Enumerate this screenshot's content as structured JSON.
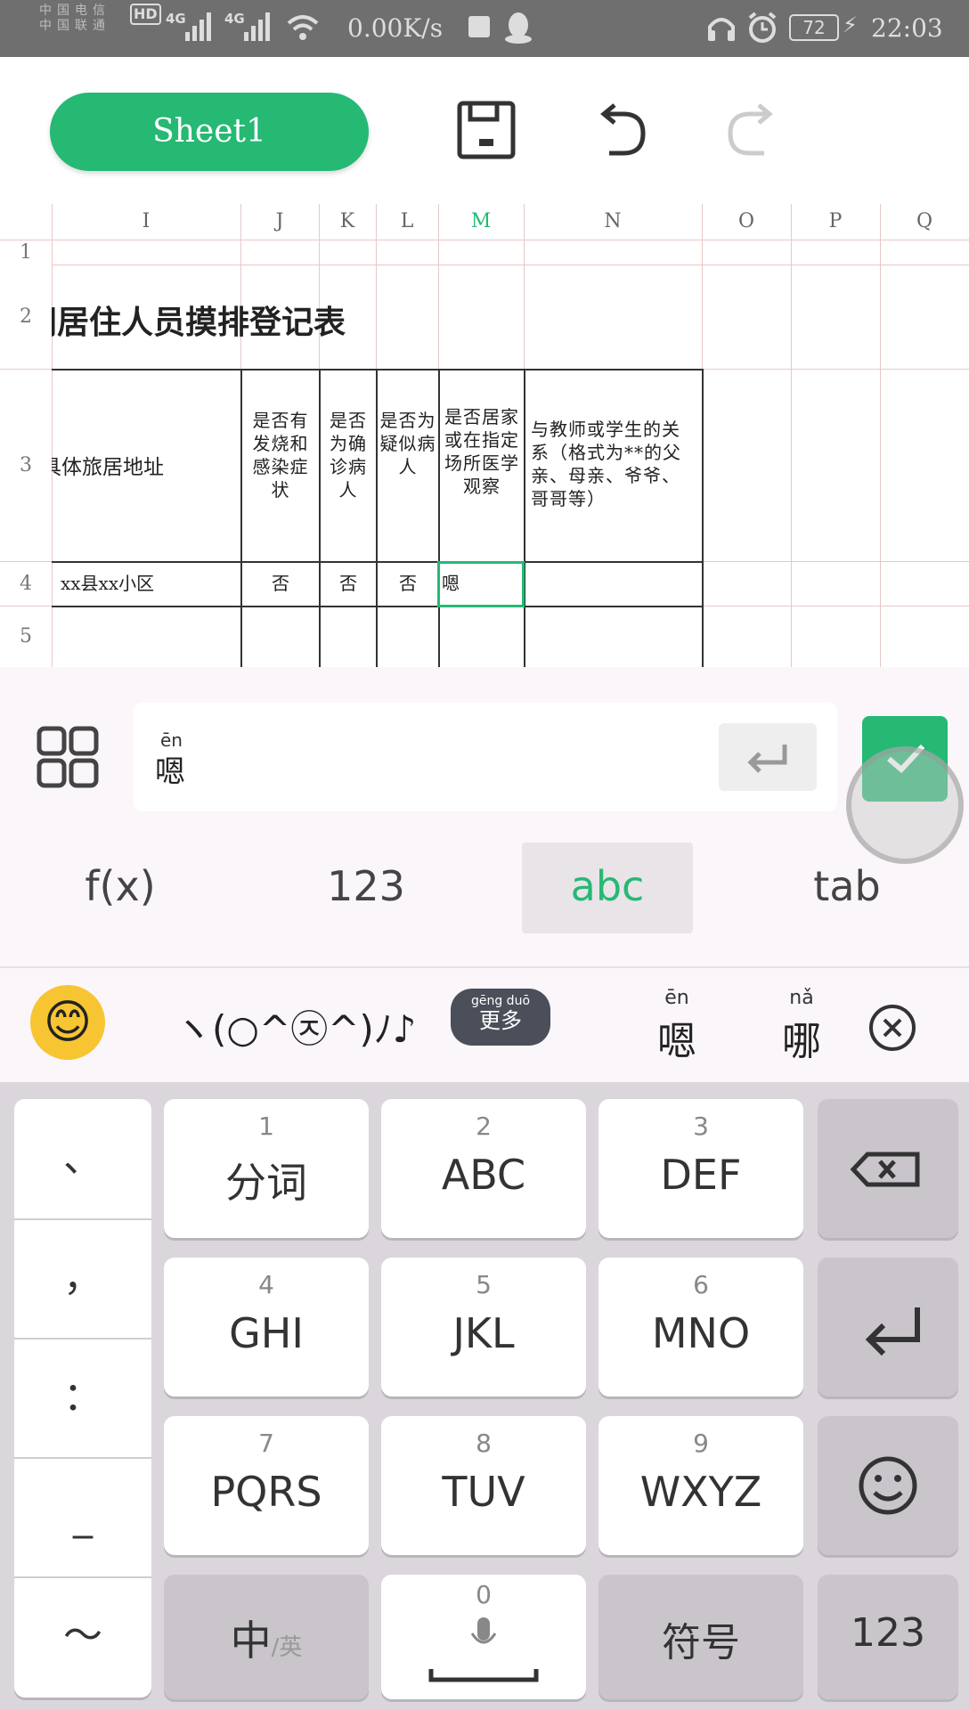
{
  "status_bar": {
    "carrier_top": "中国电信",
    "carrier_bottom": "中国联通",
    "hd": "HD",
    "net1": "4G",
    "net2": "4G",
    "speed": "0.00K/s",
    "battery": "72",
    "time": "22:03"
  },
  "toolbar": {
    "sheet_name": "Sheet1",
    "save_icon": "save-icon",
    "undo_icon": "undo-icon",
    "redo_icon": "redo-icon"
  },
  "sheet": {
    "columns": [
      "I",
      "J",
      "K",
      "L",
      "M",
      "N",
      "O",
      "P",
      "Q"
    ],
    "rows": [
      "1",
      "2",
      "3",
      "4",
      "5"
    ],
    "title": "同居住人员摸排登记表",
    "headers": {
      "I": "具体旅居地址",
      "J": "是否有发烧和感染症状",
      "K": "是否为确诊病人",
      "L": "是否为疑似病人",
      "M": "是否居家或在指定场所医学观察",
      "N": "与教师或学生的关系（格式为**的父亲、母亲、爷爷、哥哥等）"
    },
    "row4": {
      "I": "xx县xx小区",
      "J": "否",
      "K": "否",
      "L": "否",
      "M": "嗯",
      "N": ""
    },
    "selected_cell": "M4"
  },
  "formula_bar": {
    "pinyin": "ēn",
    "value": "嗯",
    "menu_icon": "grid-menu-icon",
    "enter_icon": "enter-icon",
    "confirm_icon": "check-icon"
  },
  "input_modes": [
    "f(x)",
    "123",
    "abc",
    "tab"
  ],
  "active_mode": "abc",
  "candidates": {
    "emoji": "😊",
    "kaomoji": "ヽ(○^㉨^)ﾉ♪",
    "more_pinyin": "gēng duō",
    "more_label": "更多",
    "c1_pinyin": "ēn",
    "c1": "嗯",
    "c2_pinyin": "nǎ",
    "c2": "哪",
    "close_icon": "close-icon"
  },
  "keyboard": {
    "left_column": [
      "、",
      "，",
      "：",
      "_",
      "～"
    ],
    "keys": [
      {
        "num": "1",
        "label": "分词"
      },
      {
        "num": "2",
        "label": "ABC"
      },
      {
        "num": "3",
        "label": "DEF"
      },
      {
        "num": "4",
        "label": "GHI"
      },
      {
        "num": "5",
        "label": "JKL"
      },
      {
        "num": "6",
        "label": "MNO"
      },
      {
        "num": "7",
        "label": "PQRS"
      },
      {
        "num": "8",
        "label": "TUV"
      },
      {
        "num": "9",
        "label": "WXYZ"
      }
    ],
    "zero": "0",
    "lang_main": "中",
    "lang_sub": "/英",
    "symbol": "符号",
    "num_key": "123",
    "backspace_icon": "backspace-icon",
    "enter_icon": "return-icon",
    "emoji_icon": "smiley-icon",
    "mic_icon": "microphone-icon"
  },
  "colors": {
    "accent": "#25b974",
    "status_bar": "#6f6f6f",
    "keyboard_bg": "#dad6dc"
  }
}
